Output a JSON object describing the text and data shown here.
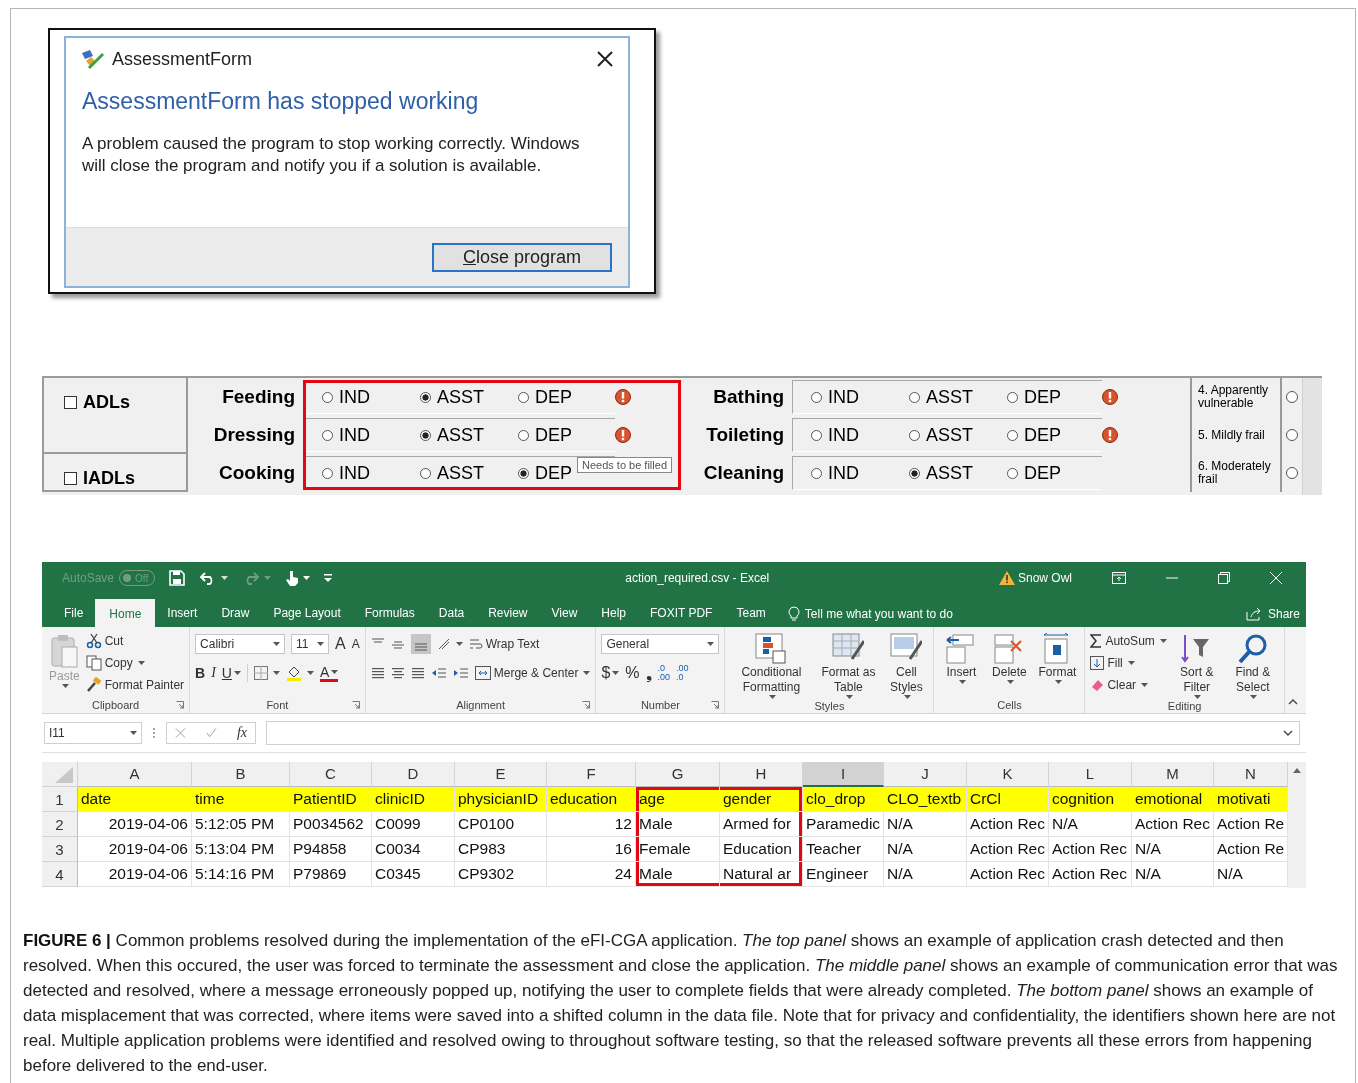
{
  "dialog": {
    "title": "AssessmentForm",
    "heading": "AssessmentForm has stopped working",
    "message": "A problem caused the program to stop working correctly. Windows will close the program and notify you if a solution is available.",
    "button": "Close program"
  },
  "form": {
    "highlight_box": true,
    "tooltip": "Needs to be filled",
    "groups": [
      {
        "label": "ADLs",
        "checked": false,
        "rows": [
          {
            "activities": [
              {
                "label": "Feeding",
                "warning": true,
                "options": [
                  {
                    "label": "IND",
                    "selected": false
                  },
                  {
                    "label": "ASST",
                    "selected": true
                  },
                  {
                    "label": "DEP",
                    "selected": false
                  }
                ]
              },
              {
                "label": "Bathing",
                "warning": true,
                "options": [
                  {
                    "label": "IND",
                    "selected": false
                  },
                  {
                    "label": "ASST",
                    "selected": false
                  },
                  {
                    "label": "DEP",
                    "selected": false
                  }
                ]
              }
            ],
            "scale": {
              "label": "4. Apparently vulnerable",
              "selected": false
            }
          },
          {
            "activities": [
              {
                "label": "Dressing",
                "warning": true,
                "options": [
                  {
                    "label": "IND",
                    "selected": false
                  },
                  {
                    "label": "ASST",
                    "selected": true
                  },
                  {
                    "label": "DEP",
                    "selected": false
                  }
                ]
              },
              {
                "label": "Toileting",
                "warning": true,
                "options": [
                  {
                    "label": "IND",
                    "selected": false
                  },
                  {
                    "label": "ASST",
                    "selected": false
                  },
                  {
                    "label": "DEP",
                    "selected": false
                  }
                ]
              }
            ],
            "scale": {
              "label": "5. Mildly frail",
              "selected": false
            }
          }
        ]
      },
      {
        "label": "IADLs",
        "checked": false,
        "rows": [
          {
            "activities": [
              {
                "label": "Cooking",
                "warning": false,
                "options": [
                  {
                    "label": "IND",
                    "selected": false
                  },
                  {
                    "label": "ASST",
                    "selected": false
                  },
                  {
                    "label": "DEP",
                    "selected": true
                  }
                ]
              },
              {
                "label": "Cleaning",
                "warning": false,
                "options": [
                  {
                    "label": "IND",
                    "selected": false
                  },
                  {
                    "label": "ASST",
                    "selected": true
                  },
                  {
                    "label": "DEP",
                    "selected": false
                  }
                ]
              }
            ],
            "scale": {
              "label": "6. Moderately frail",
              "selected": false
            }
          }
        ]
      }
    ]
  },
  "excel": {
    "autosave": "AutoSave",
    "autosave_state": "Off",
    "title": "action_required.csv  -  Excel",
    "user": "Snow Owl",
    "tabs": [
      {
        "label": "File",
        "selected": false
      },
      {
        "label": "Home",
        "selected": true
      },
      {
        "label": "Insert",
        "selected": false
      },
      {
        "label": "Draw",
        "selected": false
      },
      {
        "label": "Page Layout",
        "selected": false
      },
      {
        "label": "Formulas",
        "selected": false
      },
      {
        "label": "Data",
        "selected": false
      },
      {
        "label": "Review",
        "selected": false
      },
      {
        "label": "View",
        "selected": false
      },
      {
        "label": "Help",
        "selected": false
      },
      {
        "label": "FOXIT PDF",
        "selected": false
      },
      {
        "label": "Team",
        "selected": false
      }
    ],
    "tell_me": "Tell me what you want to do",
    "share": "Share",
    "ribbon": [
      {
        "kind": "clipboard",
        "label": "Clipboard",
        "paste": "Paste",
        "cut": "Cut",
        "copy": "Copy",
        "format_painter": "Format Painter"
      },
      {
        "kind": "font",
        "label": "Font",
        "font_name": "Calibri",
        "font_size": "11",
        "grow": "A",
        "shrink": "A",
        "bold": "B",
        "italic": "I",
        "underline": "U",
        "font_color": "A"
      },
      {
        "kind": "alignment",
        "label": "Alignment",
        "wrap": "Wrap Text",
        "merge": "Merge & Center"
      },
      {
        "kind": "number",
        "label": "Number",
        "format": "General",
        "currency": "$",
        "percent": "%",
        "comma": "❟",
        "decimals": [
          ".0",
          ".00",
          ".00",
          ".0"
        ]
      },
      {
        "kind": "styles",
        "label": "Styles",
        "items": [
          "Conditional Formatting",
          "Format as Table",
          "Cell Styles"
        ]
      },
      {
        "kind": "cells",
        "label": "Cells",
        "items": [
          "Insert",
          "Delete",
          "Format"
        ]
      },
      {
        "kind": "editing",
        "label": "Editing",
        "autosum": "AutoSum",
        "fill": "Fill",
        "clear": "Clear",
        "sort": "Sort & Filter",
        "find": "Find & Select"
      }
    ],
    "name_box": "I11",
    "fx": "fx",
    "columns": [
      {
        "letter": "A",
        "numeric": true,
        "selected": false,
        "highlighted": false
      },
      {
        "letter": "B",
        "numeric": false,
        "selected": false,
        "highlighted": false
      },
      {
        "letter": "C",
        "numeric": false,
        "selected": false,
        "highlighted": false
      },
      {
        "letter": "D",
        "numeric": false,
        "selected": false,
        "highlighted": false
      },
      {
        "letter": "E",
        "numeric": false,
        "selected": false,
        "highlighted": false
      },
      {
        "letter": "F",
        "numeric": true,
        "selected": false,
        "highlighted": false
      },
      {
        "letter": "G",
        "numeric": false,
        "selected": false,
        "highlighted": true
      },
      {
        "letter": "H",
        "numeric": false,
        "selected": false,
        "highlighted": true
      },
      {
        "letter": "I",
        "numeric": false,
        "selected": true,
        "highlighted": false
      },
      {
        "letter": "J",
        "numeric": false,
        "selected": false,
        "highlighted": false
      },
      {
        "letter": "K",
        "numeric": false,
        "selected": false,
        "highlighted": false
      },
      {
        "letter": "L",
        "numeric": false,
        "selected": false,
        "highlighted": false
      },
      {
        "letter": "M",
        "numeric": false,
        "selected": false,
        "highlighted": false
      },
      {
        "letter": "N",
        "numeric": false,
        "selected": false,
        "highlighted": false
      }
    ],
    "rows": [
      {
        "number": "1",
        "kind": "header",
        "cells": [
          "date",
          "time",
          "PatientID",
          "clinicID",
          "physicianID",
          "education",
          "age",
          "gender",
          "clo_drop",
          "CLO_textb",
          "CrCl",
          "cognition",
          "emotional",
          "motivati"
        ]
      },
      {
        "number": "2",
        "kind": "data",
        "cells": [
          "2019-04-06",
          "5:12:05 PM",
          "P0034562",
          "C0099",
          "CP0100",
          "12",
          "Male",
          "Armed for",
          "Paramedic",
          "N/A",
          "Action Rec",
          "N/A",
          "Action Rec",
          "Action Re"
        ]
      },
      {
        "number": "3",
        "kind": "data",
        "cells": [
          "2019-04-06",
          "5:13:04 PM",
          "P94858",
          "C0034",
          "CP983",
          "16",
          "Female",
          "Education",
          "Teacher",
          "N/A",
          "Action Rec",
          "Action Rec",
          "N/A",
          "Action Re"
        ]
      },
      {
        "number": "4",
        "kind": "data",
        "cells": [
          "2019-04-06",
          "5:14:16 PM",
          "P79869",
          "C0345",
          "CP9302",
          "24",
          "Male",
          "Natural ar",
          "Engineer",
          "N/A",
          "Action Rec",
          "Action Rec",
          "N/A",
          "N/A"
        ]
      }
    ]
  },
  "caption": "**FIGURE 6 |** Common problems resolved during the implementation of the eFI-CGA application. *The top panel* shows an example of application crash detected and then resolved. When this occured, the user was forced to terminate the assessment and close the application. *The middle panel* shows an example of communication error that was detected and resolved, where a message erroneously popped up, notifying the user to complete fields that were already completed. *The bottom panel* shows an example of data misplacement that was corrected, where items were saved into a shifted column in the data file. Note that for privacy and confidentiality, the identifiers shown here are not real. Multiple application problems were identified and resolved owing to throughout software testing, so that the released software prevents all these errors from happening before delivered to the end-user."
}
